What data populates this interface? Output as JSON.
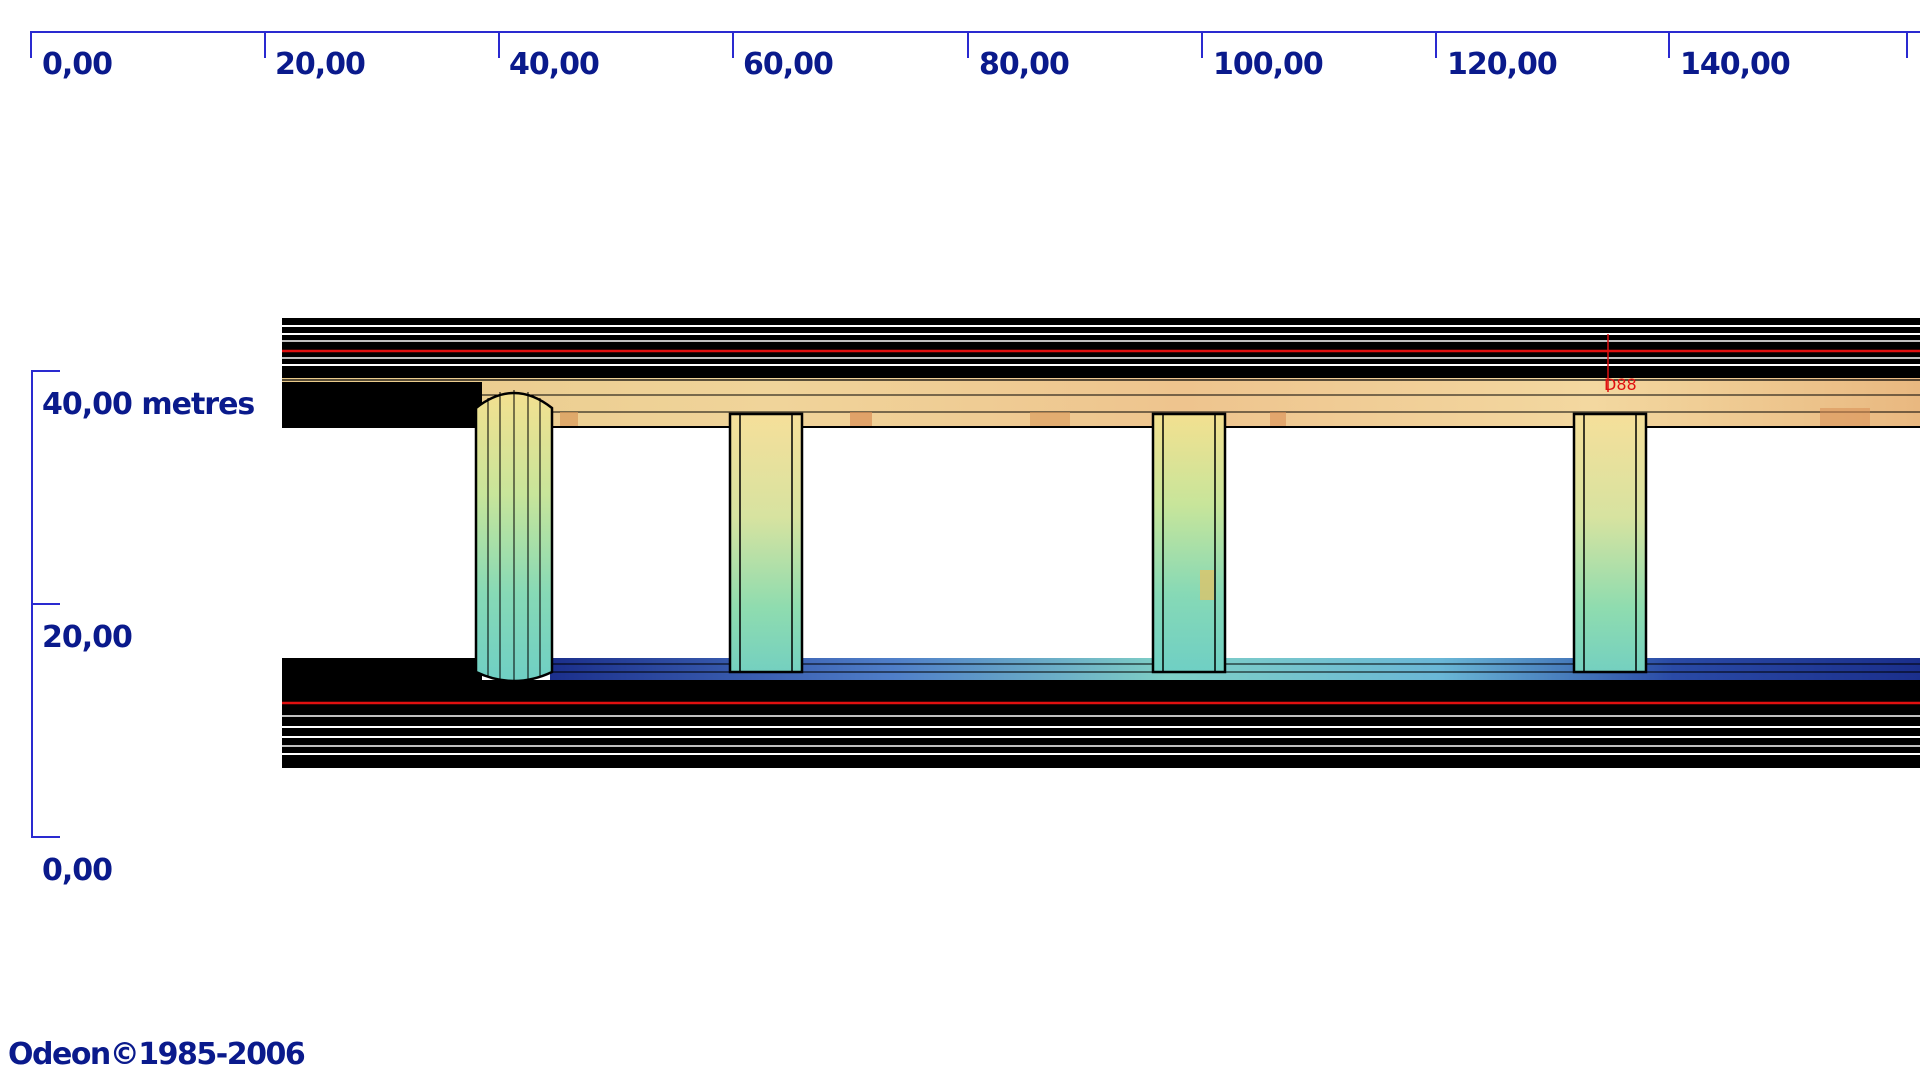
{
  "ruler": {
    "color": "#2a2ad0",
    "x_ticks": [
      "0,00",
      "20,00",
      "40,00",
      "60,00",
      "80,00",
      "100,00",
      "120,00",
      "140,00"
    ],
    "y_ticks": [
      "40,00 metres",
      "20,00",
      "0,00"
    ]
  },
  "model": {
    "label_marker": "D88",
    "color_high": "#f2c98a",
    "color_mid": "#7ed8b8",
    "color_low": "#1b2f8c",
    "wall_color": "#000000",
    "accent_line": "#e01010"
  },
  "footer": {
    "copyright": "Odeon©1985-2006"
  }
}
